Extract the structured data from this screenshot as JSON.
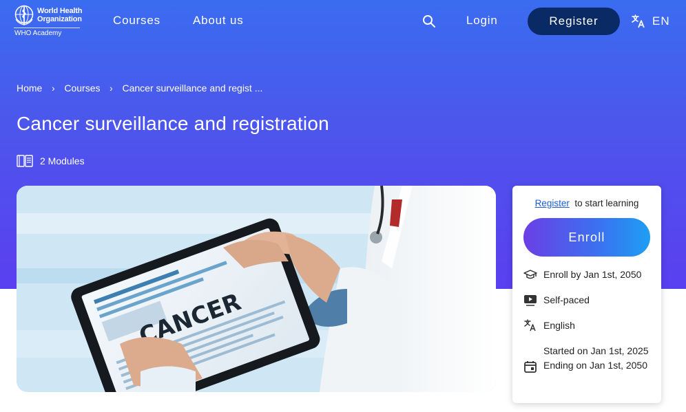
{
  "header": {
    "logo_line1": "World Health",
    "logo_line2": "Organization",
    "logo_sub": "WHO Academy",
    "nav": [
      "Courses",
      "About us"
    ],
    "login_label": "Login",
    "register_label": "Register",
    "language": "EN"
  },
  "breadcrumb": {
    "items": [
      "Home",
      "Courses",
      "Cancer surveillance and regist ..."
    ],
    "separator": "›"
  },
  "course": {
    "title": "Cancer surveillance and registration",
    "modules_label": "2 Modules",
    "image_text": "CANCER"
  },
  "card": {
    "register_link": "Register",
    "register_suffix": "to start learning",
    "enroll_label": "Enroll",
    "enroll_by": "Enroll by Jan 1st, 2050",
    "pace": "Self-paced",
    "language": "English",
    "started": "Started on Jan 1st, 2025",
    "ending": "Ending on Jan 1st, 2050"
  },
  "colors": {
    "hero_top": "#3a6cf0",
    "hero_bottom": "#5a3ff0",
    "register_button": "#0a2a66",
    "link": "#1a5cd8"
  },
  "icons": {
    "search": "search-icon",
    "language": "translate-icon",
    "modules": "book-icon",
    "enroll_by": "graduation-cap-icon",
    "pace": "play-video-icon",
    "language_row": "translate-icon",
    "dates": "calendar-icon"
  }
}
